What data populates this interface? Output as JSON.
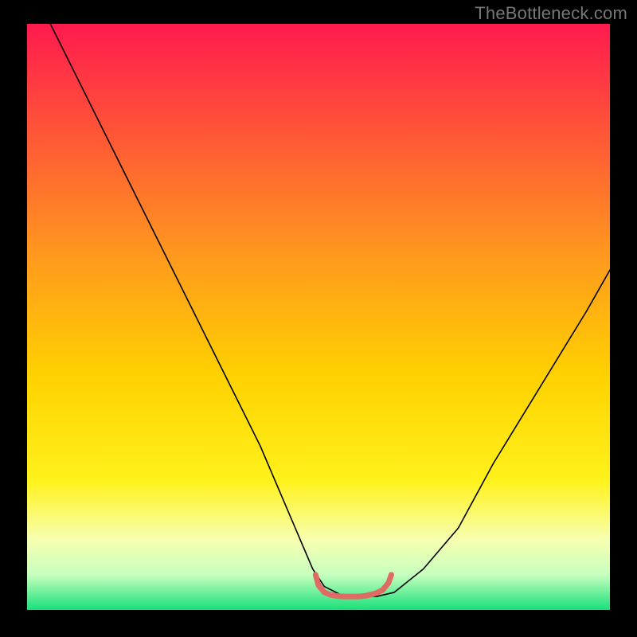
{
  "watermark": "TheBottleneck.com",
  "chart_data": {
    "type": "line",
    "title": "",
    "xlabel": "",
    "ylabel": "",
    "xlim": [
      0,
      100
    ],
    "ylim": [
      0,
      100
    ],
    "grid": false,
    "legend": false,
    "background": {
      "stops": [
        {
          "offset": 0.0,
          "color": "#ff1a4e"
        },
        {
          "offset": 0.2,
          "color": "#ff5a35"
        },
        {
          "offset": 0.4,
          "color": "#ff9a1d"
        },
        {
          "offset": 0.6,
          "color": "#ffd100"
        },
        {
          "offset": 0.78,
          "color": "#fff21c"
        },
        {
          "offset": 0.88,
          "color": "#f7ffb0"
        },
        {
          "offset": 0.94,
          "color": "#c7ffbe"
        },
        {
          "offset": 1.0,
          "color": "#18e07a"
        }
      ]
    },
    "series": [
      {
        "name": "bottleneck-curve",
        "color": "#000000",
        "width": 1.6,
        "x": [
          4,
          10,
          16,
          22,
          28,
          34,
          40,
          46,
          49,
          51,
          54,
          57,
          60,
          63,
          68,
          74,
          80,
          88,
          96,
          100
        ],
        "y": [
          100,
          88,
          76,
          64,
          52,
          40,
          28,
          14,
          7,
          4,
          2.5,
          2.3,
          2.3,
          3,
          7,
          14,
          25,
          38,
          51,
          58
        ]
      },
      {
        "name": "optimal-band",
        "color": "#e06a64",
        "width": 7,
        "x": [
          49.5,
          50,
          51,
          52,
          53,
          54,
          55,
          56,
          57,
          58,
          59,
          60,
          61,
          62,
          62.5
        ],
        "y": [
          6.0,
          4.2,
          3.0,
          2.6,
          2.4,
          2.3,
          2.3,
          2.3,
          2.3,
          2.4,
          2.6,
          2.9,
          3.4,
          4.6,
          6.0
        ]
      }
    ]
  }
}
